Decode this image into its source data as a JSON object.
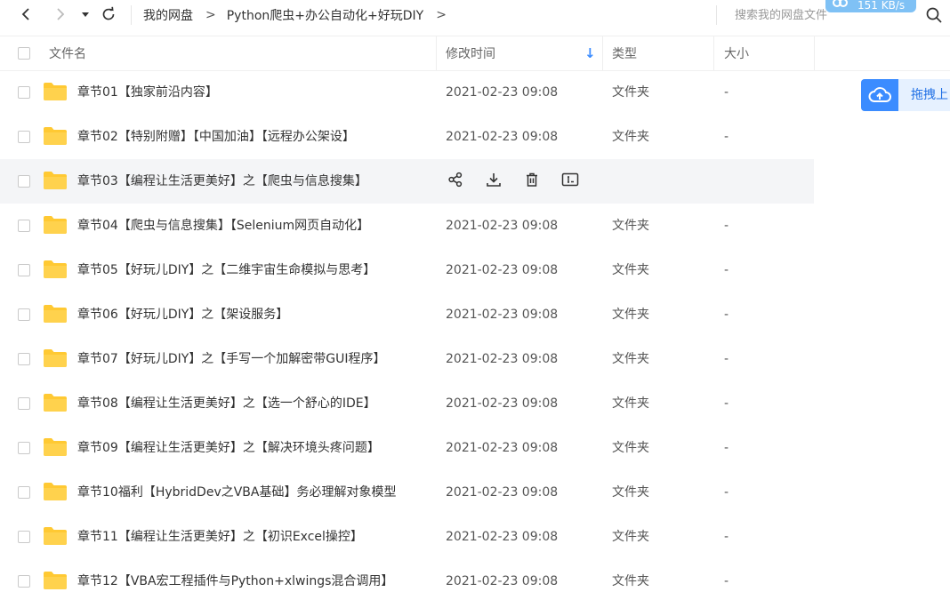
{
  "nav": {
    "back_icon": "chevron-left-icon",
    "forward_icon": "chevron-right-icon",
    "dropdown_icon": "caret-down-icon",
    "refresh_icon": "refresh-icon"
  },
  "breadcrumb": {
    "root": "我的网盘",
    "sep": ">",
    "current": "Python爬虫+办公自动化+好玩DIY",
    "trailing": ">"
  },
  "search": {
    "placeholder": "搜索我的网盘文件"
  },
  "speed": {
    "text": "151 KB/s"
  },
  "table": {
    "headers": {
      "name": "文件名",
      "mtime": "修改时间",
      "type": "类型",
      "size": "大小"
    },
    "sort_indicator": "↓",
    "rows": [
      {
        "name": "章节01【独家前沿内容】",
        "mtime": "2021-02-23 09:08",
        "type": "文件夹",
        "size": "-"
      },
      {
        "name": "章节02【特别附赠】【中国加油】【远程办公架设】",
        "mtime": "2021-02-23 09:08",
        "type": "文件夹",
        "size": "-"
      },
      {
        "name": "章节03【编程让生活更美好】之【爬虫与信息搜集】",
        "mtime": "",
        "type": "",
        "size": ""
      },
      {
        "name": "章节04【爬虫与信息搜集】【Selenium网页自动化】",
        "mtime": "2021-02-23 09:08",
        "type": "文件夹",
        "size": "-"
      },
      {
        "name": "章节05【好玩儿DIY】之【二维宇宙生命模拟与思考】",
        "mtime": "2021-02-23 09:08",
        "type": "文件夹",
        "size": "-"
      },
      {
        "name": "章节06【好玩儿DIY】之【架设服务】",
        "mtime": "2021-02-23 09:08",
        "type": "文件夹",
        "size": "-"
      },
      {
        "name": "章节07【好玩儿DIY】之【手写一个加解密带GUI程序】",
        "mtime": "2021-02-23 09:08",
        "type": "文件夹",
        "size": "-"
      },
      {
        "name": "章节08【编程让生活更美好】之【选一个舒心的IDE】",
        "mtime": "2021-02-23 09:08",
        "type": "文件夹",
        "size": "-"
      },
      {
        "name": "章节09【编程让生活更美好】之【解决环境头疼问题】",
        "mtime": "2021-02-23 09:08",
        "type": "文件夹",
        "size": "-"
      },
      {
        "name": "章节10福利【HybridDev之VBA基础】务必理解对象模型",
        "mtime": "2021-02-23 09:08",
        "type": "文件夹",
        "size": "-"
      },
      {
        "name": "章节11【编程让生活更美好】之【初识Excel操控】",
        "mtime": "2021-02-23 09:08",
        "type": "文件夹",
        "size": "-"
      },
      {
        "name": "章节12【VBA宏工程插件与Python+xlwings混合调用】",
        "mtime": "2021-02-23 09:08",
        "type": "文件夹",
        "size": "-"
      }
    ],
    "hover_row_actions": [
      "share-icon",
      "download-icon",
      "delete-icon",
      "rename-icon"
    ]
  },
  "upload": {
    "label": "拖拽上",
    "icon": "cloud-upload-icon"
  },
  "colors": {
    "accent": "#3b8cff",
    "folder": "#ffc933",
    "hover_row": "#f4f5f7"
  }
}
